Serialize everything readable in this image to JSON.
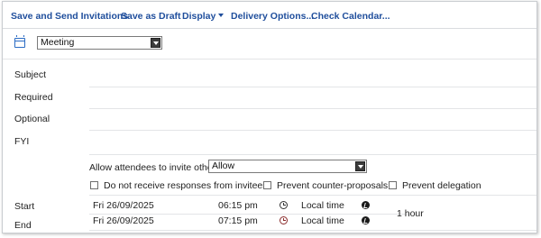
{
  "toolbar": {
    "save_send": "Save and Send Invitations",
    "save_draft": "Save as Draft",
    "display": "Display",
    "delivery": "Delivery Options...",
    "check_calendar": "Check Calendar..."
  },
  "item_type": {
    "selected": "Meeting",
    "icon": "calendar-icon"
  },
  "fields": {
    "subject": "Subject",
    "required": "Required",
    "optional": "Optional",
    "fyi": "FYI"
  },
  "invite": {
    "label": "Allow attendees to invite others",
    "selected": "Allow"
  },
  "options": {
    "no_responses": "Do not receive responses from invitees",
    "no_counter": "Prevent counter-proposals",
    "no_delegation": "Prevent delegation"
  },
  "schedule": {
    "start_label": "Start",
    "end_label": "End",
    "start_date": "Fri 26/09/2025",
    "start_time": "06:15 pm",
    "start_tz": "Local time",
    "end_date": "Fri 26/09/2025",
    "end_time": "07:15 pm",
    "end_tz": "Local time",
    "duration": "1 hour"
  },
  "colors": {
    "accent": "#1f4e9c",
    "icon_blue": "#2b6cc4"
  }
}
